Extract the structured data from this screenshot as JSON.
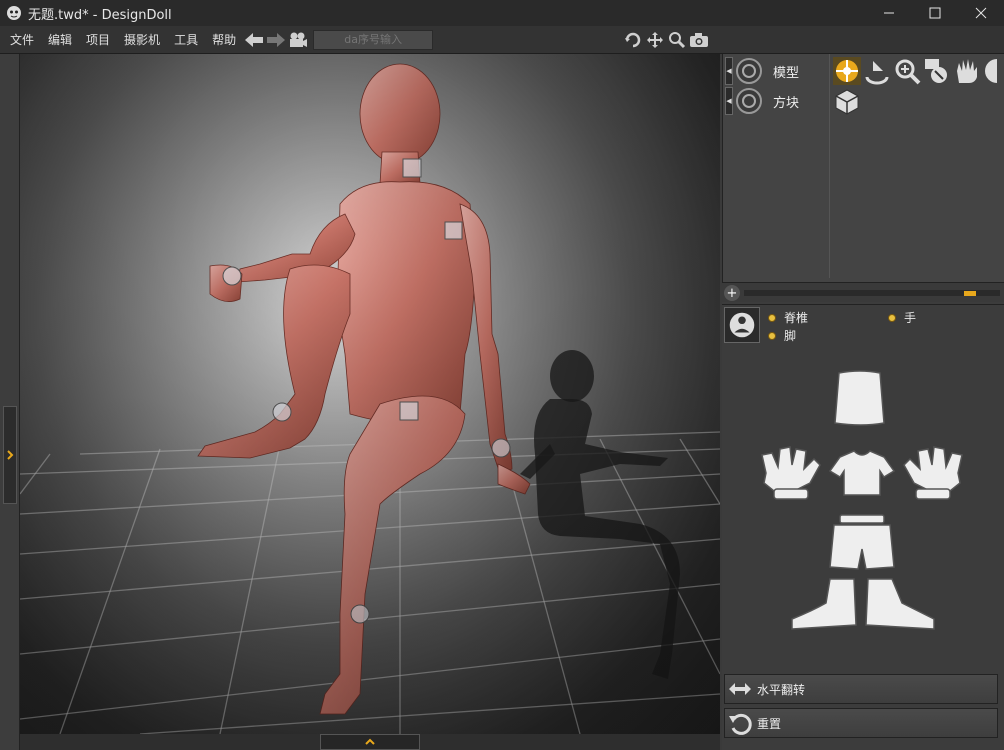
{
  "window": {
    "title": "无题.twd* - DesignDoll"
  },
  "menu": [
    "文件",
    "编辑",
    "项目",
    "摄影机",
    "工具",
    "帮助"
  ],
  "toolbar": {
    "da_placeholder": "da序号输入",
    "icons": [
      "arrow-left-icon",
      "arrow-right-icon",
      "camera-icon"
    ]
  },
  "view_tools": [
    "rotate-icon",
    "move-icon",
    "zoom-icon",
    "snapshot-icon"
  ],
  "scene": {
    "items": [
      {
        "label": "模型",
        "selected": true
      },
      {
        "label": "方块",
        "selected": false
      }
    ]
  },
  "pose": {
    "options": [
      "脊椎",
      "手",
      "脚"
    ]
  },
  "actions": {
    "flip_label": "水平翻转",
    "reset_label": "重置"
  },
  "colors": {
    "accent": "#e8a81c",
    "panel": "#3c3c3c",
    "titlebar": "#2a2a2a"
  }
}
